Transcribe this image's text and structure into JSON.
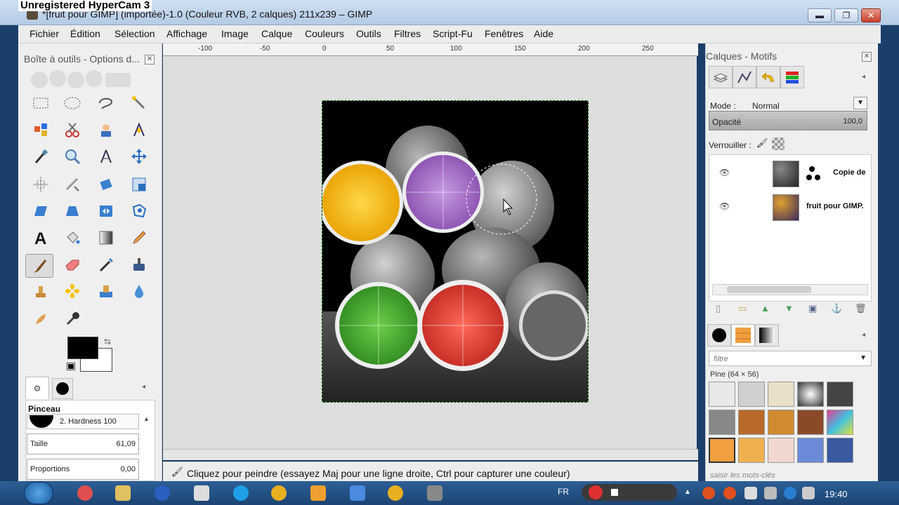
{
  "watermark": "Unregistered HyperCam 3",
  "window": {
    "title": "*[fruit pour GIMP] (importée)-1.0 (Couleur RVB, 2 calques) 211x239 – GIMP",
    "minimize": "▬",
    "maximize": "❐",
    "close": "✕"
  },
  "menu": [
    "Fichier",
    "Édition",
    "Sélection",
    "Affichage",
    "Image",
    "Calque",
    "Couleurs",
    "Outils",
    "Filtres",
    "Script-Fu",
    "Fenêtres",
    "Aide"
  ],
  "toolbox": {
    "title": "Boîte à outils - Options d...",
    "close": "✕",
    "tool_options_title": "Pinceau",
    "brush": "2. Hardness 100",
    "size_label": "Taille",
    "size_value": "61,09",
    "proportions_label": "Proportions",
    "proportions_value": "0,00"
  },
  "ruler": [
    "-100",
    "-50",
    "0",
    "50",
    "100",
    "150",
    "200",
    "250"
  ],
  "statusbar": {
    "text": "Cliquez pour peindre (essayez Maj pour une ligne droite, Ctrl pour capturer une couleur)"
  },
  "layers_panel": {
    "title": "Calques - Motifs",
    "close": "✕",
    "mode_label": "Mode :",
    "mode_value": "Normal",
    "opacity_label": "Opacité",
    "opacity_value": "100,0",
    "lock_label": "Verrouiller :",
    "layers": [
      {
        "name": "Copie de"
      },
      {
        "name": "fruit pour GIMP."
      }
    ]
  },
  "patterns_panel": {
    "filter_placeholder": "filtre",
    "pattern_name": "Pine (64 × 56)",
    "tags_placeholder": "saisir les mots-clés"
  },
  "taskbar": {
    "language": "FR",
    "clock": "19:40"
  },
  "colors": {
    "accent": "#1b3f6b",
    "selection_border": "#5bd15b",
    "fruit_yellow": "#f5b800",
    "fruit_purple": "#9a5fc0",
    "fruit_green": "#3fa12f",
    "fruit_red": "#d8322a"
  }
}
